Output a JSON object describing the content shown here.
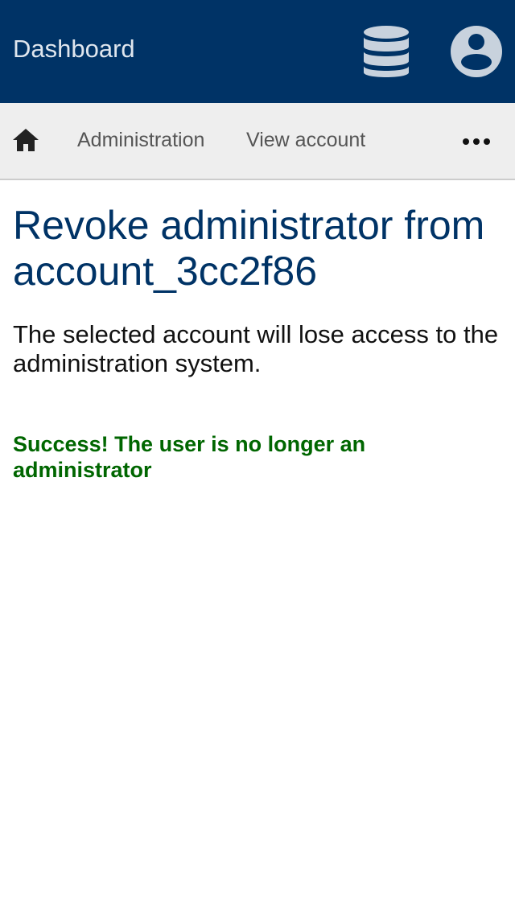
{
  "header": {
    "title": "Dashboard",
    "icons": [
      "database-icon",
      "user-account-icon"
    ],
    "background_color": "#003366"
  },
  "nav": {
    "home_icon": "home-icon",
    "items": [
      {
        "label": "Administration"
      },
      {
        "label": "View account"
      }
    ],
    "more_icon": "more-horizontal-icon"
  },
  "main": {
    "heading": "Revoke administrator from account_3cc2f86",
    "description": "The selected account will lose access to the administration system.",
    "success_message": "Success! The user is no longer an administrator",
    "heading_color": "#003366",
    "success_color": "#006600"
  }
}
